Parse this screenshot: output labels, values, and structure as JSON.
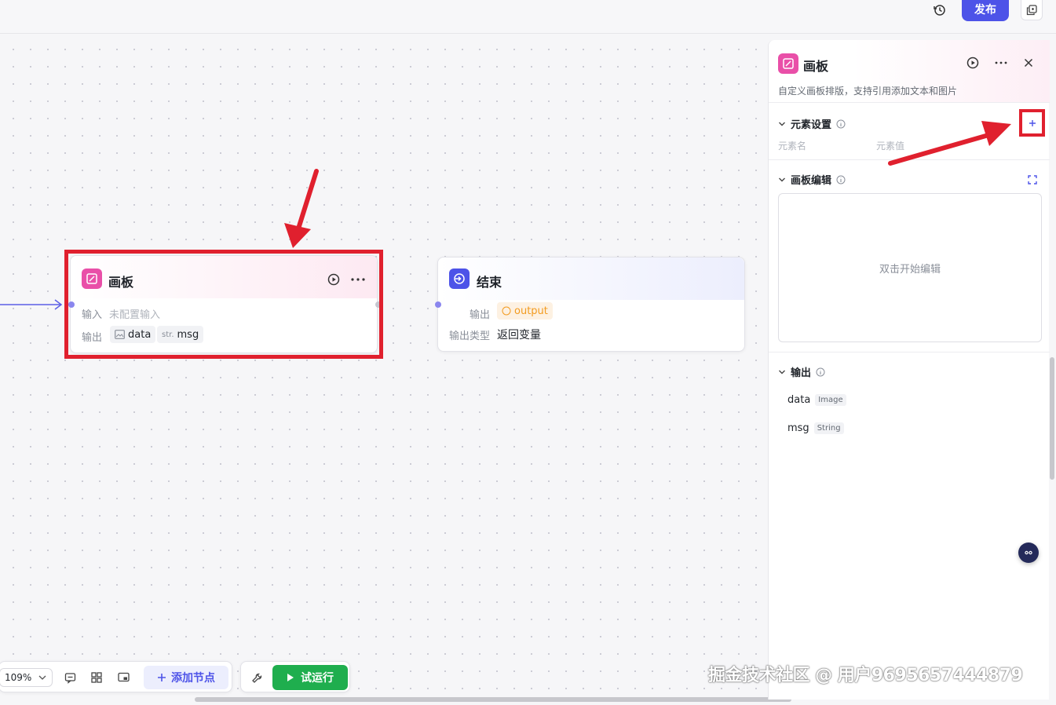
{
  "topbar": {
    "history_icon": "history-icon",
    "publish_label": "发布",
    "copy_icon": "copy-icon"
  },
  "canvas_node": {
    "title": "画板",
    "input_label": "输入",
    "input_value": "未配置输入",
    "output_label": "输出",
    "outputs": [
      {
        "type_icon": "image-icon",
        "type_abbr": "",
        "name": "data"
      },
      {
        "type_icon": "",
        "type_abbr": "str.",
        "name": "msg"
      }
    ]
  },
  "end_node": {
    "title": "结束",
    "output_label": "输出",
    "output_value": "output",
    "output_type_label": "输出类型",
    "output_type_value": "返回变量"
  },
  "toolbar": {
    "zoom": "109%",
    "add_node_label": "添加节点",
    "run_label": "试运行"
  },
  "panel": {
    "title": "画板",
    "description": "自定义画板排版，支持引用添加文本和图片",
    "element_settings": {
      "title": "元素设置",
      "col_name": "元素名",
      "col_value": "元素值"
    },
    "board_edit": {
      "title": "画板编辑",
      "placeholder": "双击开始编辑"
    },
    "output": {
      "title": "输出",
      "items": [
        {
          "name": "data",
          "type": "Image"
        },
        {
          "name": "msg",
          "type": "String"
        }
      ]
    }
  },
  "watermark": "掘金技术社区 @ 用户9695657444879",
  "colors": {
    "accent": "#4d53e8",
    "run_green": "#1fae4e",
    "annotation_red": "#e0202e",
    "canvas_node_icon": "#e94fa8",
    "end_node_icon": "#4d53e8",
    "output_tag": "#f39b1f"
  }
}
